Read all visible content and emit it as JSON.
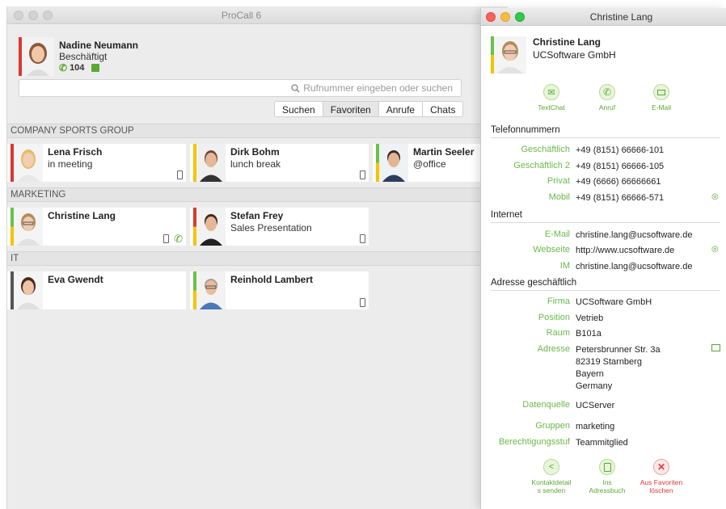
{
  "main_window": {
    "title": "ProCall 6",
    "me": {
      "name": "Nadine Neumann",
      "status": "Beschäftigt",
      "extension": "104"
    },
    "search": {
      "placeholder": "Rufnummer eingeben oder suchen"
    },
    "tabs": [
      {
        "label": "Suchen",
        "active": false
      },
      {
        "label": "Favoriten",
        "active": true
      },
      {
        "label": "Anrufe",
        "active": false
      },
      {
        "label": "Chats",
        "active": false
      }
    ],
    "groups": [
      {
        "name": "COMPANY SPORTS GROUP"
      },
      {
        "name": "MARKETING"
      },
      {
        "name": "IT"
      }
    ],
    "contacts": [
      {
        "name": "Lena Frisch",
        "status": "in meeting",
        "presence": [
          "#d93a30",
          "#d93a30"
        ],
        "icons": [
          "mobile-icon"
        ]
      },
      {
        "name": "Dirk Bohm",
        "status": "lunch break",
        "presence": [
          "#f5c400",
          "#f5c400"
        ],
        "icons": [
          "mobile-icon"
        ]
      },
      {
        "name": "Martin Seeler",
        "status": "@office",
        "presence": [
          "#6cc04a",
          "#f5c400"
        ],
        "icons": []
      },
      {
        "name": "Christine Lang",
        "status": "",
        "presence": [
          "#6cc04a",
          "#f5c400"
        ],
        "icons": [
          "mobile-icon",
          "phone-icon"
        ]
      },
      {
        "name": "Stefan Frey",
        "status": "Sales Presentation",
        "presence": [
          "#d93a30",
          "#f5c400"
        ],
        "icons": [
          "mobile-icon"
        ]
      },
      {
        "name": "Eva Gwendt",
        "status": "",
        "presence": [
          "#555555",
          "#555555"
        ],
        "icons": []
      },
      {
        "name": "Reinhold Lambert",
        "status": "",
        "presence": [
          "#6cc04a",
          "#f5c400"
        ],
        "icons": [
          "mobile-icon"
        ]
      }
    ]
  },
  "detail_window": {
    "title": "Christine Lang",
    "name": "Christine Lang",
    "company": "UCSoftware GmbH",
    "actions_top": [
      {
        "label": "TextChat",
        "icon": "chat-icon"
      },
      {
        "label": "Anruf",
        "icon": "phone-icon"
      },
      {
        "label": "E-Mail",
        "icon": "mail-icon"
      }
    ],
    "sections": {
      "phone": "Telefonnummern",
      "internet": "Internet",
      "address": "Adresse geschäftlich"
    },
    "phones": [
      {
        "label": "Geschäftlich",
        "value": "+49 (8151) 66666-101"
      },
      {
        "label": "Geschäftlich 2",
        "value": "+49 (8151) 66666-105"
      },
      {
        "label": "Privat",
        "value": "+49 (6666) 66666661"
      },
      {
        "label": "Mobil",
        "value": "+49 (8151) 66666-571"
      }
    ],
    "internet": [
      {
        "label": "E-Mail",
        "value": "christine.lang@ucsoftware.de"
      },
      {
        "label": "Webseite",
        "value": "http://www.ucsoftware.de"
      },
      {
        "label": "IM",
        "value": "christine.lang@ucsoftware.de"
      }
    ],
    "address": {
      "firma": {
        "label": "Firma",
        "value": "UCSoftware GmbH"
      },
      "position": {
        "label": "Position",
        "value": "Vetrieb"
      },
      "raum": {
        "label": "Raum",
        "value": "B101a"
      },
      "adresse": {
        "label": "Adresse",
        "lines": [
          "Petersbrunner Str. 3a",
          "82319 Starnberg",
          "Bayern",
          "Germany"
        ]
      },
      "datenquelle": {
        "label": "Datenquelle",
        "value": "UCServer"
      },
      "gruppen": {
        "label": "Gruppen",
        "value": "marketing"
      },
      "berechtigung": {
        "label": "Berechtigungsstuf",
        "value": "Teammitglied"
      }
    },
    "actions_bottom": [
      {
        "label_line1": "Kontaktdetail",
        "label_line2": "s senden",
        "icon": "share-icon"
      },
      {
        "label_line1": "Ins",
        "label_line2": "Adressbuch",
        "icon": "addressbook-icon"
      },
      {
        "label_line1": "Aus Favoriten",
        "label_line2": "löschen",
        "icon": "remove-icon"
      }
    ]
  },
  "colors": {
    "accent_green": "#6bb84a",
    "danger_red": "#e0393a",
    "presence_red": "#d93a30",
    "presence_yellow": "#f5c400",
    "presence_green": "#6cc04a"
  }
}
